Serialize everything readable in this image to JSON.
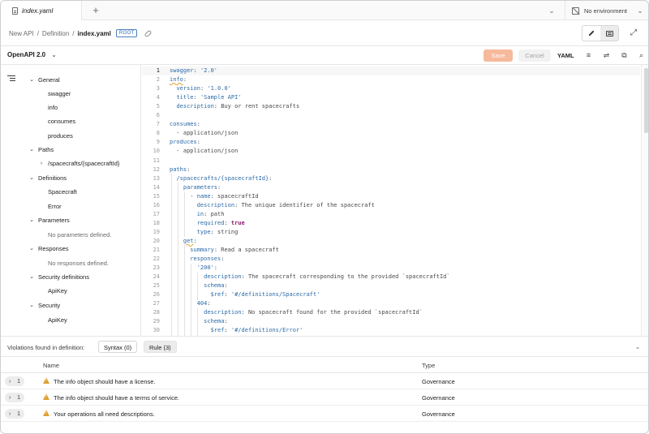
{
  "tab": {
    "label": "index.yaml",
    "add_icon": "plus-icon",
    "dropdown_icon": "chevron-down-icon"
  },
  "environment": {
    "label": "No environment",
    "icon": "environment-off-icon"
  },
  "breadcrumb": {
    "items": [
      "New API",
      "Definition"
    ],
    "separator": "/",
    "current": "index.yaml",
    "badge": "ROOT"
  },
  "toolbar": {
    "spec_version": "OpenAPI 2.0",
    "save_label": "Save",
    "cancel_label": "Cancel",
    "format_label": "YAML"
  },
  "sidebar": {
    "sections": [
      {
        "label": "General",
        "items": [
          "swagger",
          "info",
          "consumes",
          "produces"
        ]
      },
      {
        "label": "Paths",
        "items": [
          "/spacecrafts/{spacecraftId}"
        ]
      },
      {
        "label": "Definitions",
        "items": [
          "Spacecraft",
          "Error"
        ]
      },
      {
        "label": "Parameters",
        "empty": "No parameters defined."
      },
      {
        "label": "Responses",
        "empty": "No responses defined."
      },
      {
        "label": "Security definitions",
        "items": [
          "ApiKey"
        ]
      },
      {
        "label": "Security",
        "items": [
          "ApiKey"
        ]
      }
    ]
  },
  "editor": {
    "line_numbers": [
      "1",
      "2",
      "3",
      "4",
      "5",
      "6",
      "7",
      "8",
      "9",
      "10",
      "11",
      "12",
      "13",
      "14",
      "15",
      "16",
      "17",
      "18",
      "19",
      "20",
      "21",
      "22",
      "23",
      "24",
      "25",
      "26",
      "27",
      "28",
      "29",
      "30"
    ],
    "lines": [
      "swagger: '2.0'",
      "info:",
      "  version: '1.0.0'",
      "  title: 'Sample API'",
      "  description: Buy or rent spacecrafts",
      "",
      "consumes:",
      "  - application/json",
      "produces:",
      "  - application/json",
      "",
      "paths:",
      "  /spacecrafts/{spacecraftId}:",
      "    parameters:",
      "      - name: spacecraftId",
      "        description: The unique identifier of the spacecraft",
      "        in: path",
      "        required: true",
      "        type: string",
      "    get:",
      "      summary: Read a spacecraft",
      "      responses:",
      "        '200':",
      "          description: The spacecraft corresponding to the provided `spacecraftId`",
      "          schema:",
      "            $ref: '#/definitions/Spacecraft'",
      "        404:",
      "          description: No spacecraft found for the provided `spacecraftId`",
      "          schema:",
      "            $ref: '#/definitions/Error'"
    ]
  },
  "violations": {
    "label": "Violations found in definition:",
    "tabs": {
      "syntax": "Syntax (0)",
      "rule": "Rule (3)"
    },
    "columns": {
      "name": "Name",
      "type": "Type"
    },
    "rows": [
      {
        "count": "1",
        "message": "The info object should have a license.",
        "type": "Governance"
      },
      {
        "count": "1",
        "message": "The info object should have a terms of service.",
        "type": "Governance"
      },
      {
        "count": "1",
        "message": "Your operations all need descriptions.",
        "type": "Governance"
      }
    ]
  },
  "colors": {
    "accent": "#f7b99c",
    "warning": "#e0a030",
    "key": "#2a6aa8",
    "boolean": "#8a1a6b",
    "badge": "#2f6bb3"
  }
}
